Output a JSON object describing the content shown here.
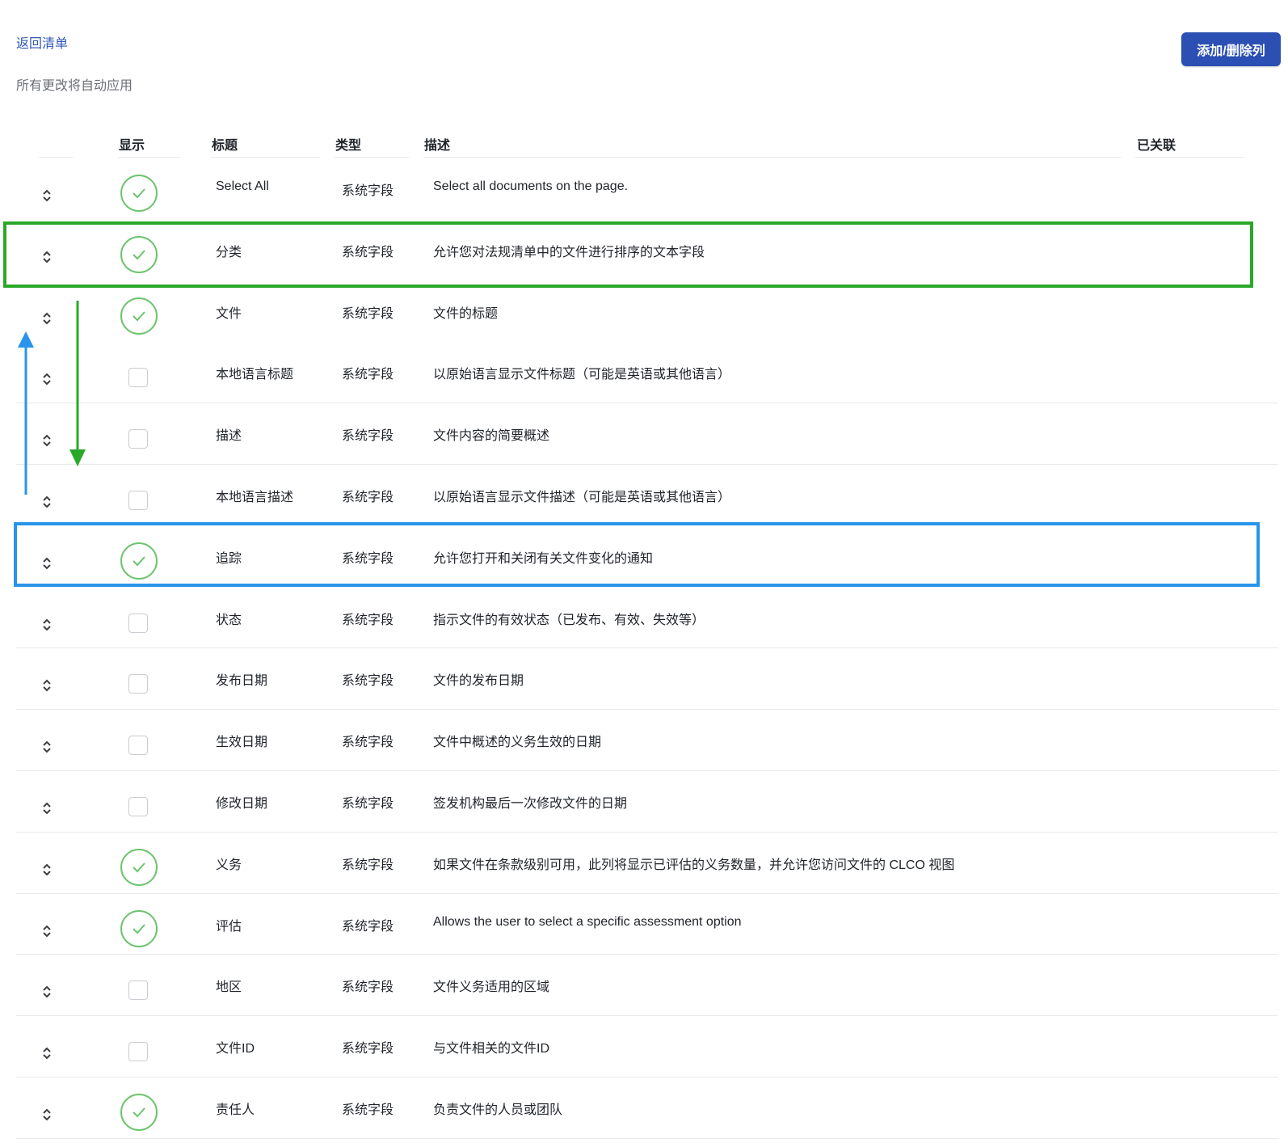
{
  "header": {
    "back_link": "返回清单",
    "auto_note": "所有更改将自动应用",
    "add_remove_button": "添加/删除列"
  },
  "table": {
    "columns": {
      "show": "显示",
      "title": "标题",
      "type": "类型",
      "description": "描述",
      "linked": "已关联"
    },
    "rows": [
      {
        "title": "Select All",
        "type": "系统字段",
        "description": "Select all documents on the page.",
        "shown": true
      },
      {
        "title": "分类",
        "type": "系统字段",
        "description": "允许您对法规清单中的文件进行排序的文本字段",
        "shown": true
      },
      {
        "title": "文件",
        "type": "系统字段",
        "description": "文件的标题",
        "shown": true
      },
      {
        "title": "本地语言标题",
        "type": "系统字段",
        "description": "以原始语言显示文件标题（可能是英语或其他语言）",
        "shown": false
      },
      {
        "title": "描述",
        "type": "系统字段",
        "description": "文件内容的简要概述",
        "shown": false
      },
      {
        "title": "本地语言描述",
        "type": "系统字段",
        "description": "以原始语言显示文件描述（可能是英语或其他语言）",
        "shown": false
      },
      {
        "title": "追踪",
        "type": "系统字段",
        "description": "允许您打开和关闭有关文件变化的通知",
        "shown": true
      },
      {
        "title": "状态",
        "type": "系统字段",
        "description": "指示文件的有效状态（已发布、有效、失效等）",
        "shown": false
      },
      {
        "title": "发布日期",
        "type": "系统字段",
        "description": "文件的发布日期",
        "shown": false
      },
      {
        "title": "生效日期",
        "type": "系统字段",
        "description": "文件中概述的义务生效的日期",
        "shown": false
      },
      {
        "title": "修改日期",
        "type": "系统字段",
        "description": "签发机构最后一次修改文件的日期",
        "shown": false
      },
      {
        "title": "义务",
        "type": "系统字段",
        "description": "如果文件在条款级别可用，此列将显示已评估的义务数量，并允许您访问文件的 CLCO 视图",
        "shown": true
      },
      {
        "title": "评估",
        "type": "系统字段",
        "description": "Allows the user to select a specific assessment option",
        "shown": true
      },
      {
        "title": "地区",
        "type": "系统字段",
        "description": "文件义务适用的区域",
        "shown": false
      },
      {
        "title": "文件ID",
        "type": "系统字段",
        "description": "与文件相关的文件ID",
        "shown": false
      },
      {
        "title": "责任人",
        "type": "系统字段",
        "description": "负责文件的人员或团队",
        "shown": true
      }
    ]
  },
  "colors": {
    "accent": "#2b4fb3",
    "check_green": "#6cc46c",
    "highlight_green": "#2aa82a",
    "highlight_blue": "#2894ea"
  },
  "icons": [
    "drag-handle-icon",
    "check-icon",
    "arrow-up-icon",
    "arrow-down-icon"
  ]
}
